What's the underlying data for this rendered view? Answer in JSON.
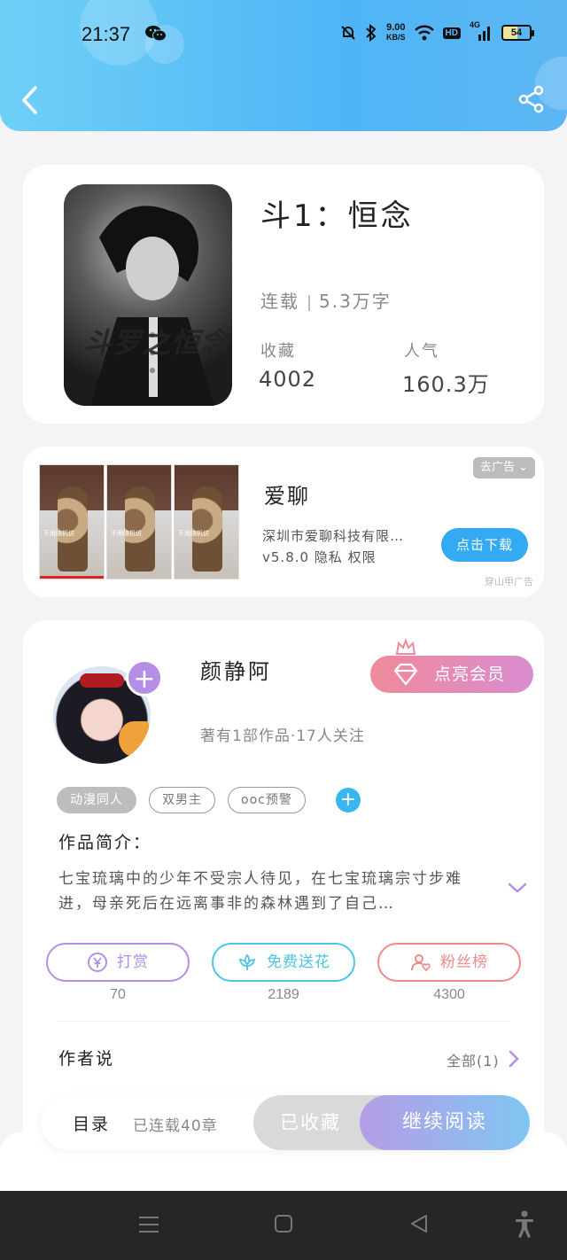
{
  "status_bar": {
    "time": "21:37",
    "speed_value": "9.00",
    "speed_unit": "KB/S",
    "hd": "HD",
    "network": "4G",
    "battery": "54"
  },
  "header": {
    "back_icon": "chevron-left-icon",
    "share_icon": "share-icon"
  },
  "book": {
    "cover_text": "斗罗之恒念",
    "title": "斗1：恒念",
    "status": "连载",
    "word_count": "5.3万字",
    "favorites_label": "收藏",
    "favorites_value": "4002",
    "popularity_label": "人气",
    "popularity_value": "160.3万"
  },
  "ad": {
    "image_caption": "不用随机访",
    "app_name": "爱聊",
    "company": "深圳市爱聊科技有限…",
    "version_line": "v5.8.0 隐私 权限",
    "close_label": "去广告",
    "download_label": "点击下载",
    "source": "穿山甲广告"
  },
  "author": {
    "name": "颜静阿",
    "info": "著有1部作品·17人关注",
    "vip_label": "点亮会员",
    "tags": [
      "动漫同人",
      "双男主",
      "ooc预警"
    ],
    "intro_title": "作品简介：",
    "intro_text": "七宝琉璃中的少年不受宗人待见，在七宝琉璃宗寸步难进，母亲死后在远离事非的森林遇到了自己…",
    "actions": [
      {
        "label": "打赏",
        "count": "70",
        "color": "#b48ee6"
      },
      {
        "label": "免费送花",
        "count": "2189",
        "color": "#4cc4e8"
      },
      {
        "label": "粉丝榜",
        "count": "4300",
        "color": "#ef8a8a"
      }
    ],
    "author_say_title": "作者说",
    "author_say_all": "全部(1)"
  },
  "bottom_bar": {
    "toc_label": "目录",
    "chapters": "已连载40章",
    "collected_label": "已收藏",
    "continue_label": "继续阅读"
  },
  "colors": {
    "header_start": "#6fd0f7",
    "header_end": "#4fb5f6",
    "download_button": "#33aaf1",
    "vip_start": "#f08a9a",
    "vip_end": "#d98cd0"
  }
}
